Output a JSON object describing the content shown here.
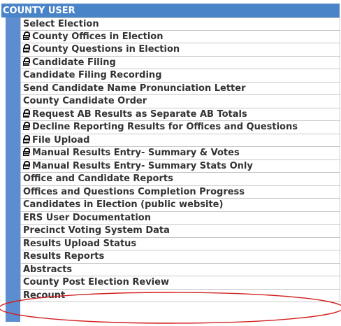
{
  "header": {
    "title": "COUNTY USER"
  },
  "menu": {
    "items": [
      {
        "label": "Select Election",
        "locked": false
      },
      {
        "label": "County Offices in Election",
        "locked": true
      },
      {
        "label": "County Questions in Election",
        "locked": true
      },
      {
        "label": "Candidate Filing",
        "locked": true
      },
      {
        "label": "Candidate Filing Recording",
        "locked": false
      },
      {
        "label": "Send Candidate Name Pronunciation Letter",
        "locked": false
      },
      {
        "label": "County Candidate Order",
        "locked": false
      },
      {
        "label": "Request AB Results as Separate AB Totals",
        "locked": true
      },
      {
        "label": "Decline Reporting Results for Offices and Questions",
        "locked": true
      },
      {
        "label": "File Upload",
        "locked": true
      },
      {
        "label": "Manual Results Entry- Summary & Votes",
        "locked": true
      },
      {
        "label": "Manual Results Entry- Summary Stats Only",
        "locked": true
      },
      {
        "label": "Office and Candidate Reports",
        "locked": false
      },
      {
        "label": "Offices and Questions Completion Progress",
        "locked": false
      },
      {
        "label": "Candidates in Election (public website)",
        "locked": false
      },
      {
        "label": "ERS User Documentation",
        "locked": false
      },
      {
        "label": "Precinct Voting System Data",
        "locked": false
      },
      {
        "label": "Results Upload Status",
        "locked": false
      },
      {
        "label": "Results Reports",
        "locked": false
      },
      {
        "label": "Abstracts",
        "locked": false
      },
      {
        "label": "County Post Election Review",
        "locked": false
      },
      {
        "label": "Recount",
        "locked": false
      }
    ]
  },
  "colors": {
    "header_bg": "#4a84c8",
    "sidebar_bg": "#5b8dd0",
    "annotation": "#d42020"
  },
  "icons": {
    "locked_item": "lock-icon"
  }
}
